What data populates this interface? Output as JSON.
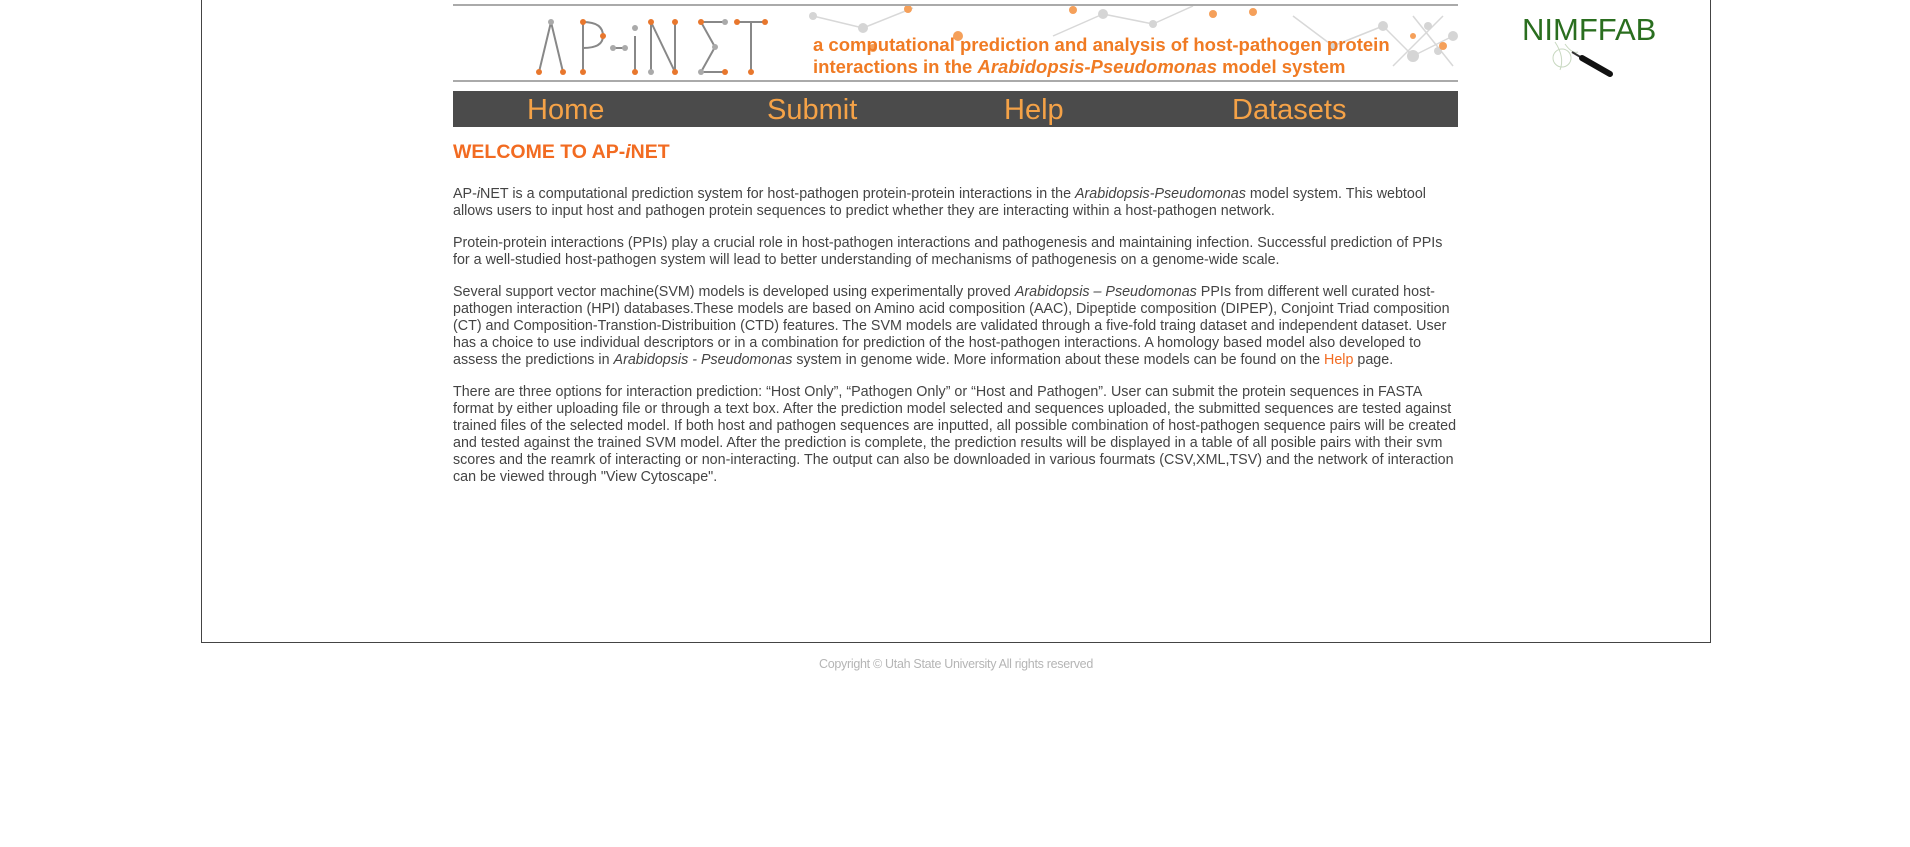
{
  "banner": {
    "logo_text": "AP-iNET",
    "tagline_line1": "a computational prediction and analysis of host-pathogen protein",
    "tagline_line2_prefix": "interactions in the ",
    "tagline_line2_italic": "Arabidopsis-Pseudomonas",
    "tagline_line2_suffix": " model system"
  },
  "partner_logo": {
    "text": "NIMFFAB",
    "icon": "magnifier-icon"
  },
  "nav": {
    "home": "Home",
    "submit": "Submit",
    "help": "Help",
    "datasets": "Datasets"
  },
  "colors": {
    "accent": "#f26b21",
    "nav_bg": "#4b4b4b",
    "nav_text": "#f5a247",
    "partner_green": "#2a6e1f"
  },
  "page": {
    "title_prefix": "WELCOME TO AP-",
    "title_italic": "i",
    "title_suffix": "NET",
    "p1_a": "AP-",
    "p1_b": "i",
    "p1_c": "NET is a computational prediction system for host-pathogen protein-protein interactions in the ",
    "p1_d": "Arabidopsis-Pseudomonas",
    "p1_e": " model system. This webtool allows users to input host and pathogen protein sequences to predict whether they are interacting within a host-pathogen network.",
    "p2": "Protein-protein interactions (PPIs) play a crucial role in host-pathogen interactions and pathogenesis and maintaining infection. Successful prediction of PPIs for a well-studied host-pathogen system will lead to better understanding of mechanisms of pathogenesis on a genome-wide scale.",
    "p3_a": "Several support vector machine(SVM) models is developed using experimentally proved ",
    "p3_b": "Arabidopsis – Pseudomonas",
    "p3_c": " PPIs from different well curated host-pathogen interaction (HPI) databases.These models are based on Amino acid composition (AAC), Dipeptide composition (DIPEP), Conjoint Triad composition (CT) and Composition-Transtion-Distribuition (CTD) features. The SVM models are validated through a five-fold traing dataset and independent dataset. User has a choice to use individual descriptors or in a combination for prediction of the host-pathogen interactions. A homology based model also developed to assess the predictions in ",
    "p3_d": "Arabidopsis - Pseudomonas",
    "p3_e": " system in genome wide. More information about these models can be found on the ",
    "p3_link": "Help",
    "p3_f": " page.",
    "p4": "There are three options for interaction prediction: “Host Only”, “Pathogen Only” or “Host and Pathogen”. User can submit the protein sequences in FASTA format by either uploading file or through a text box. After the prediction model selected and sequences uploaded, the submitted sequences are tested against trained files of the selected model. If both host and pathogen sequences are inputted, all possible combination of host-pathogen sequence pairs will be created and tested against the trained SVM model. After the prediction is complete, the prediction results will be displayed in a table of all posible pairs with their svm scores and the reamrk of interacting or non-interacting. The output can also be downloaded in various fourmats (CSV,XML,TSV) and the network of interaction can be viewed through \"View Cytoscape\"."
  },
  "footer": {
    "copyright": "Copyright © Utah State University All rights reserved"
  }
}
